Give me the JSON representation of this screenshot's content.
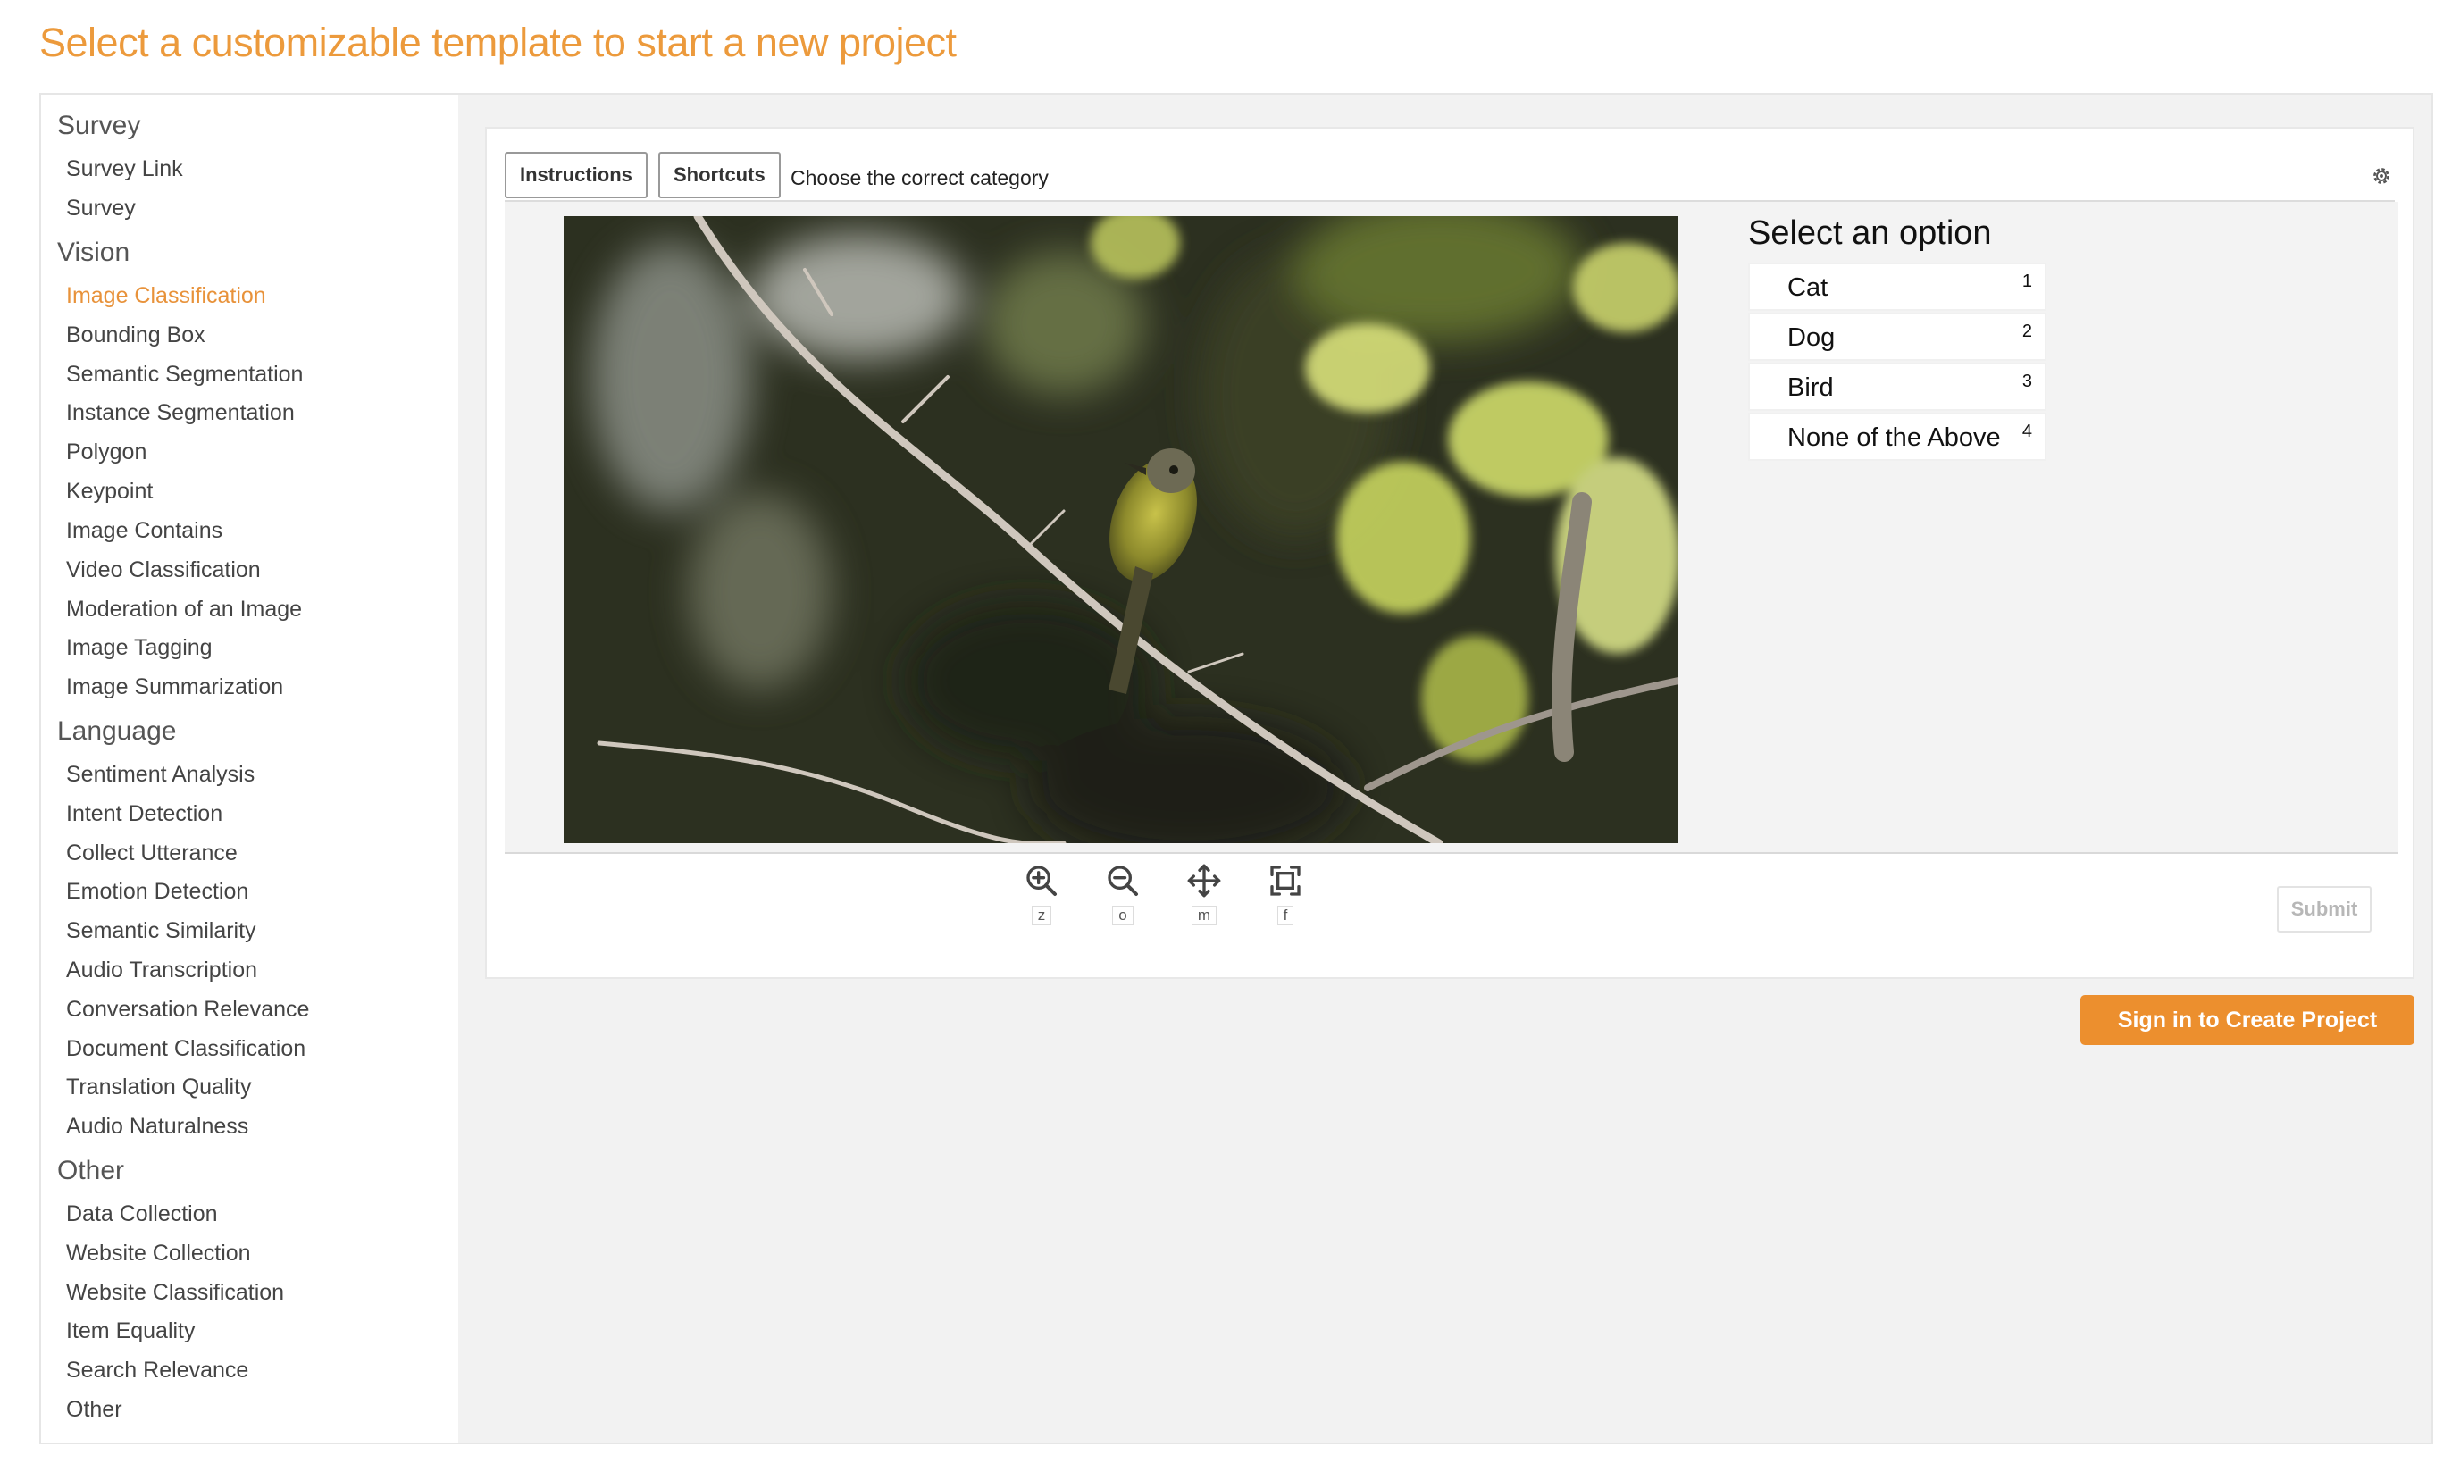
{
  "page_title": "Select a customizable template to start a new project",
  "colors": {
    "accent": "#ec9a3c",
    "button": "#ec8f2e"
  },
  "sidebar": {
    "sections": [
      {
        "title": "Survey",
        "items": [
          "Survey Link",
          "Survey"
        ]
      },
      {
        "title": "Vision",
        "items": [
          "Image Classification",
          "Bounding Box",
          "Semantic Segmentation",
          "Instance Segmentation",
          "Polygon",
          "Keypoint",
          "Image Contains",
          "Video Classification",
          "Moderation of an Image",
          "Image Tagging",
          "Image Summarization"
        ]
      },
      {
        "title": "Language",
        "items": [
          "Sentiment Analysis",
          "Intent Detection",
          "Collect Utterance",
          "Emotion Detection",
          "Semantic Similarity",
          "Audio Transcription",
          "Conversation Relevance",
          "Document Classification",
          "Translation Quality",
          "Audio Naturalness"
        ]
      },
      {
        "title": "Other",
        "items": [
          "Data Collection",
          "Website Collection",
          "Website Classification",
          "Item Equality",
          "Search Relevance",
          "Other"
        ]
      }
    ],
    "active_item": "Image Classification"
  },
  "toolbar": {
    "instructions_label": "Instructions",
    "shortcuts_label": "Shortcuts",
    "prompt": "Choose the correct category",
    "settings_icon": "gear-icon"
  },
  "options": {
    "title": "Select an option",
    "items": [
      {
        "label": "Cat",
        "key": "1"
      },
      {
        "label": "Dog",
        "key": "2"
      },
      {
        "label": "Bird",
        "key": "3"
      },
      {
        "label": "None of the Above",
        "key": "4"
      }
    ]
  },
  "tools": [
    {
      "icon": "zoom-in-icon",
      "key": "z"
    },
    {
      "icon": "zoom-out-icon",
      "key": "o"
    },
    {
      "icon": "move-icon",
      "key": "m"
    },
    {
      "icon": "fit-screen-icon",
      "key": "f"
    }
  ],
  "submit_label": "Submit",
  "signin_label": "Sign in to Create Project"
}
